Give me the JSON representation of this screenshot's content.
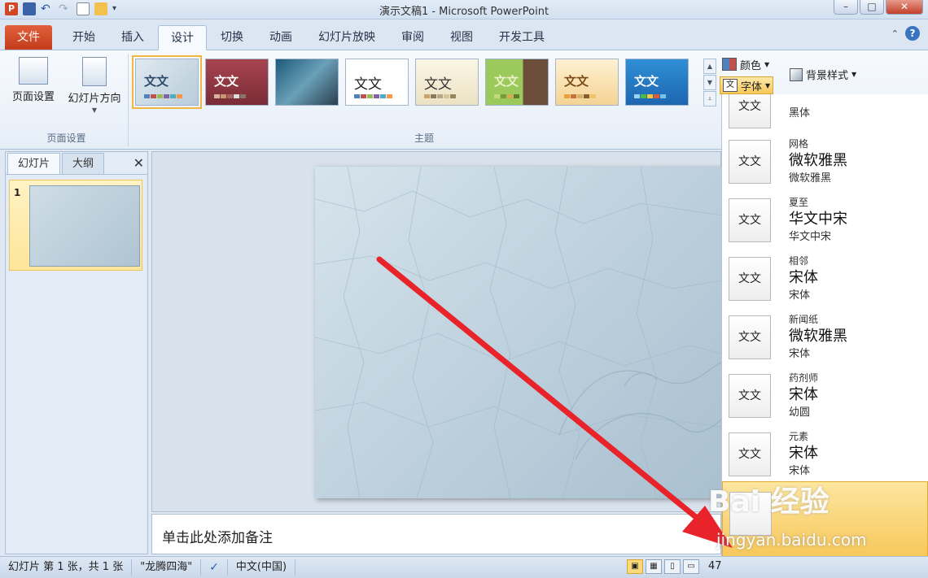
{
  "window": {
    "title": "演示文稿1 - Microsoft PowerPoint",
    "app_icon_letter": "P"
  },
  "ribbon_tabs": [
    {
      "label": "文件"
    },
    {
      "label": "开始"
    },
    {
      "label": "插入"
    },
    {
      "label": "设计"
    },
    {
      "label": "切换"
    },
    {
      "label": "动画"
    },
    {
      "label": "幻灯片放映"
    },
    {
      "label": "审阅"
    },
    {
      "label": "视图"
    },
    {
      "label": "开发工具"
    }
  ],
  "page_setup_group": {
    "page_setup": "页面设置",
    "orientation": "幻灯片方向",
    "group_label": "页面设置"
  },
  "theme_group": {
    "group_label": "主题",
    "theme_text": "文文"
  },
  "options_group": {
    "colors": "颜色",
    "fonts": "字体",
    "background": "背景样式"
  },
  "slide_pane": {
    "tab_slides": "幻灯片",
    "tab_outline": "大纲",
    "close_symbol": "✕",
    "slide_number": "1"
  },
  "notes": {
    "placeholder": "单击此处添加备注"
  },
  "font_list": {
    "preview_text": "文文",
    "items": [
      {
        "name": "",
        "heading": "",
        "body": "黑体"
      },
      {
        "name": "网格",
        "heading": "微软雅黑",
        "body": "微软雅黑"
      },
      {
        "name": "夏至",
        "heading": "华文中宋",
        "body": "华文中宋"
      },
      {
        "name": "相邻",
        "heading": "宋体",
        "body": "宋体"
      },
      {
        "name": "新闻纸",
        "heading": "微软雅黑",
        "body": "宋体"
      },
      {
        "name": "药剂师",
        "heading": "宋体",
        "body": "幼圆"
      },
      {
        "name": "元素",
        "heading": "宋体",
        "body": "宋体"
      },
      {
        "name": "",
        "heading": "",
        "body": ""
      }
    ]
  },
  "status_bar": {
    "slide_info": "幻灯片 第 1 张，共 1 张",
    "theme_name": "\"龙腾四海\"",
    "language": "中文(中国)",
    "zoom": "47"
  },
  "watermark": {
    "logo": "Bai 经验",
    "url": "jingyan.baidu.com"
  },
  "colors": {
    "file_tab": "#d24726",
    "accent_arrow": "#e8232a",
    "highlight": "#f6c24e"
  }
}
